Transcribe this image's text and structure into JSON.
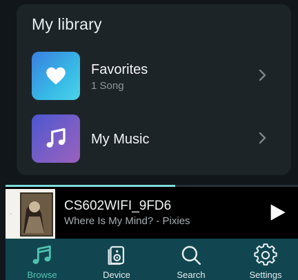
{
  "library": {
    "title": "My library",
    "items": [
      {
        "title": "Favorites",
        "subtitle": "1 Song",
        "icon": "heart-icon"
      },
      {
        "title": "My Music",
        "subtitle": "",
        "icon": "music-note-icon"
      }
    ]
  },
  "now_playing": {
    "device": "CS602WIFI_9FD6",
    "track": "Where Is My Mind? - Pixies",
    "progress": 0.58,
    "play_icon": "play-icon"
  },
  "tabs": [
    {
      "label": "Browse",
      "icon": "music-note-icon",
      "active": true
    },
    {
      "label": "Device",
      "icon": "speaker-icon",
      "active": false
    },
    {
      "label": "Search",
      "icon": "search-icon",
      "active": false
    },
    {
      "label": "Settings",
      "icon": "gear-icon",
      "active": false
    }
  ],
  "colors": {
    "background": "#101619",
    "card": "#1d2428",
    "tabbar": "#114650",
    "accent": "#4fc3b0"
  }
}
